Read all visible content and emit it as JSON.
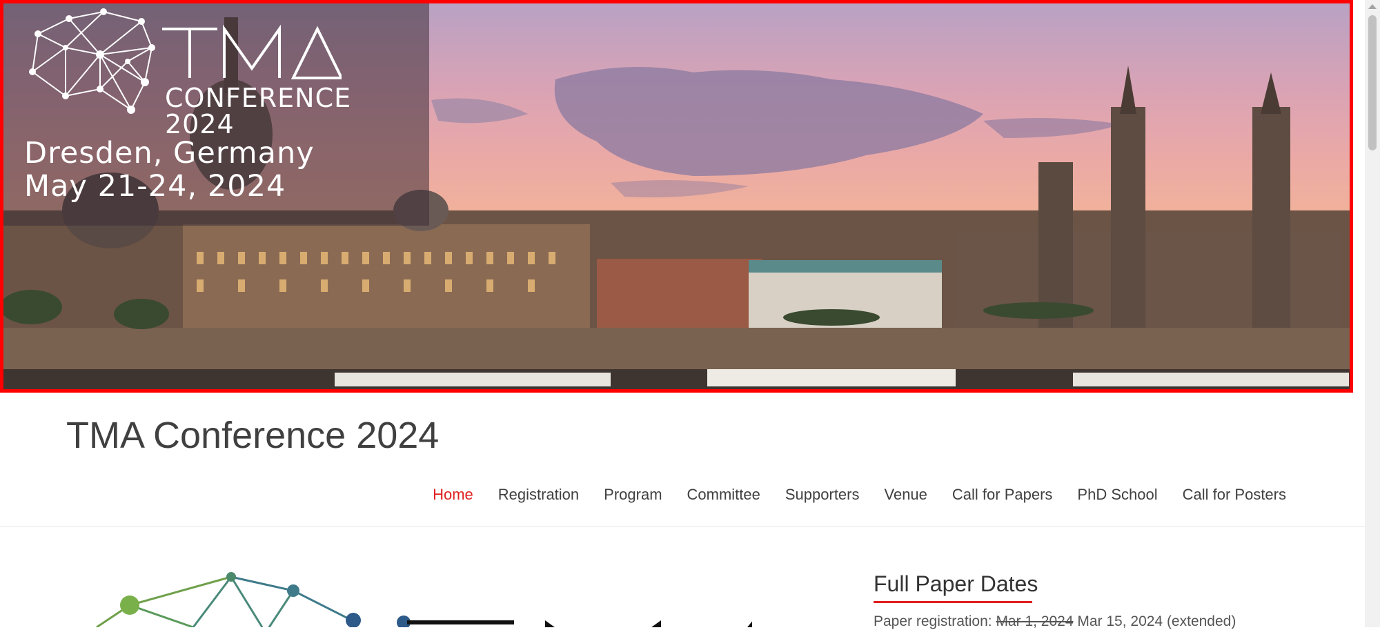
{
  "banner": {
    "logo_letters": "TMA",
    "conference_label": "CONFERENCE",
    "year": "2024",
    "city": "Dresden, Germany",
    "dates": "May 21-24, 2024"
  },
  "header": {
    "site_title": "TMA Conference 2024"
  },
  "nav": {
    "items": [
      {
        "label": "Home",
        "active": true
      },
      {
        "label": "Registration"
      },
      {
        "label": "Program"
      },
      {
        "label": "Committee"
      },
      {
        "label": "Supporters"
      },
      {
        "label": "Venue"
      },
      {
        "label": "Call for Papers"
      },
      {
        "label": "PhD School"
      },
      {
        "label": "Call for Posters"
      }
    ]
  },
  "content": {
    "full_paper_dates": {
      "title": "Full Paper Dates",
      "registration_label": "Paper registration:",
      "registration_old": "Mar 1, 2024",
      "registration_new": "Mar 15, 2024 (extended)"
    }
  },
  "colors": {
    "accent": "#e02020",
    "text": "#404040",
    "banner_border": "#ff0000"
  }
}
